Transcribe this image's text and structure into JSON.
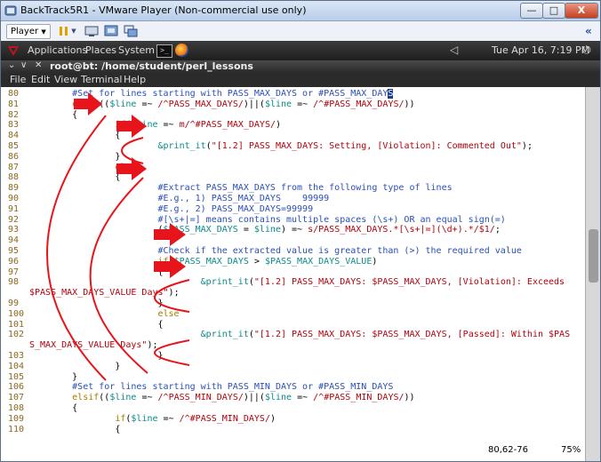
{
  "window": {
    "title": "BackTrack5R1 - VMware Player (Non-commercial use only)",
    "min_glyph": "—",
    "max_glyph": "□",
    "close_glyph": "X"
  },
  "player": {
    "menu_label": "Player",
    "overflow_glyph": "«"
  },
  "gnome": {
    "applications": "Applications",
    "places": "Places",
    "system": "System",
    "clock": "Tue Apr 16,  7:19 PM"
  },
  "terminal": {
    "title": "root@bt: /home/student/perl_lessons",
    "menu": [
      "File",
      "Edit",
      "View",
      "Terminal",
      "Help"
    ]
  },
  "code_lines": [
    {
      "n": "80",
      "segs": [
        [
          "cm",
          "        #Set for lines starting with PASS_MAX_DAYS or #PASS_MAX_DAY"
        ],
        [
          "hl",
          "S"
        ]
      ]
    },
    {
      "n": "81",
      "segs": [
        [
          "kw",
          "        elsif"
        ],
        [
          "",
          "(("
        ],
        [
          "vr",
          "$line"
        ],
        [
          "",
          " =~ "
        ],
        [
          "rx",
          "/^PASS_MAX_DAYS/"
        ],
        [
          "",
          ")||("
        ],
        [
          "vr",
          "$line"
        ],
        [
          "",
          " =~ "
        ],
        [
          "rx",
          "/^#PASS_MAX_DAYS/"
        ],
        [
          "",
          "))"
        ]
      ]
    },
    {
      "n": "82",
      "segs": [
        [
          "",
          "        {"
        ]
      ]
    },
    {
      "n": "83",
      "segs": [
        [
          "kw",
          "                if"
        ],
        [
          "",
          "("
        ],
        [
          "vr",
          "$line"
        ],
        [
          "",
          " =~ "
        ],
        [
          "rx",
          "m/^#PASS_MAX_DAYS/"
        ],
        [
          "",
          ")"
        ]
      ]
    },
    {
      "n": "84",
      "segs": [
        [
          "",
          "                {"
        ]
      ]
    },
    {
      "n": "85",
      "segs": [
        [
          "fn",
          "                        &print_it"
        ],
        [
          "",
          "("
        ],
        [
          "st",
          "\"[1.2] PASS_MAX_DAYS: Setting, [Violation]: Commented Out\""
        ],
        [
          "",
          ");"
        ]
      ]
    },
    {
      "n": "86",
      "segs": [
        [
          "",
          "                }"
        ]
      ]
    },
    {
      "n": "87",
      "segs": [
        [
          "kw",
          "                else"
        ]
      ]
    },
    {
      "n": "88",
      "segs": [
        [
          "",
          "                {"
        ]
      ]
    },
    {
      "n": "89",
      "segs": [
        [
          "cm",
          "                        #Extract PASS_MAX_DAYS from the following type of lines"
        ]
      ]
    },
    {
      "n": "90",
      "segs": [
        [
          "cm",
          "                        #E.g., 1) PASS_MAX_DAYS    99999"
        ]
      ]
    },
    {
      "n": "91",
      "segs": [
        [
          "cm",
          "                        #E.g., 2) PASS_MAX_DAYS=99999"
        ]
      ]
    },
    {
      "n": "92",
      "segs": [
        [
          "cm",
          "                        #[\\s+|=] means contains multiple spaces (\\s+) OR an equal sign(=)"
        ]
      ]
    },
    {
      "n": "93",
      "segs": [
        [
          "",
          "                        ("
        ],
        [
          "vr",
          "$PASS_MAX_DAYS"
        ],
        [
          "",
          " = "
        ],
        [
          "vr",
          "$line"
        ],
        [
          "",
          ") =~ "
        ],
        [
          "rx",
          "s/PASS_MAX_DAYS.*[\\s+|=](\\d+).*/$1/"
        ],
        [
          "",
          ";"
        ]
      ]
    },
    {
      "n": "94",
      "segs": [
        [
          "",
          ""
        ]
      ]
    },
    {
      "n": "95",
      "segs": [
        [
          "cm",
          "                        #Check if the extracted value is greater than (>) the required value"
        ]
      ]
    },
    {
      "n": "96",
      "segs": [
        [
          "kw",
          "                        if"
        ],
        [
          "",
          "("
        ],
        [
          "vr",
          "$PASS_MAX_DAYS"
        ],
        [
          "",
          " > "
        ],
        [
          "vr",
          "$PASS_MAX_DAYS_VALUE"
        ],
        [
          "",
          ")"
        ]
      ]
    },
    {
      "n": "97",
      "segs": [
        [
          "",
          "                        {"
        ]
      ]
    },
    {
      "n": "98",
      "segs": [
        [
          "fn",
          "                                &print_it"
        ],
        [
          "",
          "("
        ],
        [
          "st",
          "\"[1.2] PASS_MAX_DAYS: $PASS_MAX_DAYS, [Violation]: Exceeds"
        ]
      ]
    },
    {
      "n": "",
      "segs": [
        [
          "st",
          "$PASS_MAX_DAYS_VALUE Days\""
        ],
        [
          "",
          ");"
        ]
      ]
    },
    {
      "n": "99",
      "segs": [
        [
          "",
          "                        }"
        ]
      ]
    },
    {
      "n": "100",
      "segs": [
        [
          "kw",
          "                        else"
        ]
      ]
    },
    {
      "n": "101",
      "segs": [
        [
          "",
          "                        {"
        ]
      ]
    },
    {
      "n": "102",
      "segs": [
        [
          "fn",
          "                                &print_it"
        ],
        [
          "",
          "("
        ],
        [
          "st",
          "\"[1.2] PASS_MAX_DAYS: $PASS_MAX_DAYS, [Passed]: Within $PAS"
        ]
      ]
    },
    {
      "n": "",
      "segs": [
        [
          "st",
          "S_MAX_DAYS_VALUE Days\""
        ],
        [
          "",
          ");"
        ]
      ]
    },
    {
      "n": "103",
      "segs": [
        [
          "",
          "                        }"
        ]
      ]
    },
    {
      "n": "104",
      "segs": [
        [
          "",
          "                }"
        ]
      ]
    },
    {
      "n": "105",
      "segs": [
        [
          "",
          "        }"
        ]
      ]
    },
    {
      "n": "106",
      "segs": [
        [
          "cm",
          "        #Set for lines starting with PASS_MIN_DAYS or #PASS_MIN_DAYS"
        ]
      ]
    },
    {
      "n": "107",
      "segs": [
        [
          "kw",
          "        elsif"
        ],
        [
          "",
          "(("
        ],
        [
          "vr",
          "$line"
        ],
        [
          "",
          " =~ "
        ],
        [
          "rx",
          "/^PASS_MIN_DAYS/"
        ],
        [
          "",
          ")||("
        ],
        [
          "vr",
          "$line"
        ],
        [
          "",
          " =~ "
        ],
        [
          "rx",
          "/^#PASS_MIN_DAYS/"
        ],
        [
          "",
          "))"
        ]
      ]
    },
    {
      "n": "108",
      "segs": [
        [
          "",
          "        {"
        ]
      ]
    },
    {
      "n": "109",
      "segs": [
        [
          "kw",
          "                if"
        ],
        [
          "",
          "("
        ],
        [
          "vr",
          "$line"
        ],
        [
          "",
          " =~ "
        ],
        [
          "rx",
          "/^#PASS_MIN_DAYS/"
        ],
        [
          "",
          ")"
        ]
      ]
    },
    {
      "n": "110",
      "segs": [
        [
          "",
          "                {"
        ]
      ]
    }
  ],
  "status": {
    "position": "80,62-76",
    "percent": "75%"
  },
  "colors": {
    "annotation": "#e8141b",
    "comment": "#2a4fb5",
    "keyword": "#a57a00",
    "regex": "#b3000b",
    "variable": "#0a8a8a"
  }
}
